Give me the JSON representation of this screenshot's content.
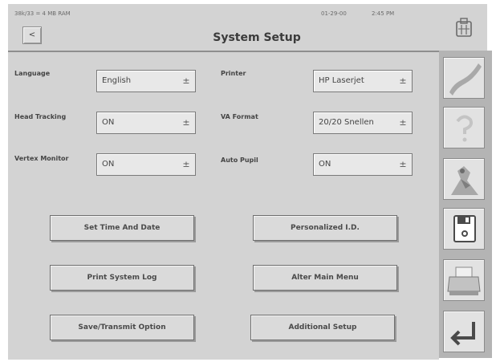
{
  "status": {
    "memory": "38k/33 = 4 MB RAM",
    "date": "01-29-00",
    "time": "2:45 PM"
  },
  "header": {
    "title": "System Setup",
    "back_label": "<"
  },
  "settings": [
    {
      "label": "Language",
      "value": "English"
    },
    {
      "label": "Printer",
      "value": "HP Laserjet"
    },
    {
      "label": "Head Tracking",
      "value": "ON"
    },
    {
      "label": "VA Format",
      "value": "20/20 Snellen"
    },
    {
      "label": "Vertex Monitor",
      "value": "ON"
    },
    {
      "label": "Auto Pupil",
      "value": "ON"
    }
  ],
  "dropdown_arrow": "±",
  "buttons": {
    "set_time": "Set Time And Date",
    "personalized": "Personalized I.D.",
    "print_log": "Print System Log",
    "alter_menu": "Alter Main Menu",
    "save_transmit": "Save/Transmit Option",
    "additional": "Additional Setup"
  },
  "toolbar": {
    "items": [
      {
        "icon": "curve-graph-icon"
      },
      {
        "icon": "help-question-icon"
      },
      {
        "icon": "diagnostic-head-icon"
      },
      {
        "icon": "floppy-disk-icon"
      },
      {
        "icon": "printer-icon"
      },
      {
        "icon": "return-arrow-icon"
      }
    ]
  },
  "colors": {
    "panel": "#d3d3d3",
    "toolbar": "#b4b4b4",
    "text": "#444444"
  }
}
